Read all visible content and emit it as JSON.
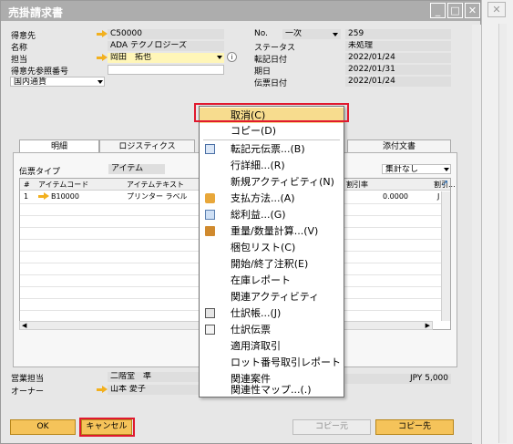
{
  "window": {
    "title": "売掛請求書"
  },
  "header": {
    "customer_label": "得意先",
    "customer_value": "C50000",
    "name_label": "名称",
    "name_value": "ADA テクノロジーズ",
    "contact_label": "担当",
    "contact_value": "岡田　拓也",
    "customer_ref_label": "得意先参照番号",
    "currency_value": "国内通貨",
    "no_label": "No.",
    "no_series": "一次",
    "no_value": "259",
    "status_label": "ステータス",
    "status_value": "未処理",
    "posting_date_label": "転記日付",
    "posting_date_value": "2022/01/24",
    "due_date_label": "期日",
    "due_date_value": "2022/01/31",
    "document_date_label": "伝票日付",
    "document_date_value": "2022/01/24"
  },
  "tabs": [
    {
      "label": "明細"
    },
    {
      "label": "ロジスティクス"
    },
    {
      "label": "添付文書"
    }
  ],
  "grid": {
    "doc_type_label": "伝票タイプ",
    "doc_type_value": "アイテム",
    "summary_value": "集計なし",
    "columns": [
      "#",
      "アイテムコード",
      "アイテムテキスト",
      "割引率",
      "割引..."
    ],
    "rows": [
      {
        "num": "1",
        "item_code": "B10000",
        "item_text": "プリンター ラベル",
        "discount": "0.0000",
        "extra": "J"
      }
    ]
  },
  "footer": {
    "sales_employee_label": "営業担当",
    "sales_employee_value": "二階堂　準",
    "owner_label": "オーナー",
    "owner_value": "山本 愛子",
    "total_value": "JPY 5,000"
  },
  "buttons": {
    "ok": "OK",
    "cancel": "キャンセル",
    "copy_from": "コピー元",
    "copy_to": "コピー先"
  },
  "context_menu": {
    "items": [
      {
        "label": "取消(C)"
      },
      {
        "label": "コピー(D)"
      },
      {
        "label": "転記元伝票...(B)"
      },
      {
        "label": "行詳細...(R)"
      },
      {
        "label": "新規アクティビティ(N)"
      },
      {
        "label": "支払方法...(A)"
      },
      {
        "label": "総利益...(G)"
      },
      {
        "label": "重量/数量計算...(V)"
      },
      {
        "label": "梱包リスト(C)"
      },
      {
        "label": "開始/終了注釈(E)"
      },
      {
        "label": "在庫レポート"
      },
      {
        "label": "関連アクティビティ"
      },
      {
        "label": "仕訳帳...(J)"
      },
      {
        "label": "仕訳伝票"
      },
      {
        "label": "適用済取引"
      },
      {
        "label": "ロット番号取引レポート"
      },
      {
        "label": "関連案件"
      },
      {
        "label": "関連性マップ...(.)"
      }
    ]
  },
  "colors": {
    "titlebar": "#adadad",
    "button": "#f5c35a",
    "highlight": "#e0192e",
    "link_arrow": "#f2b01e"
  }
}
